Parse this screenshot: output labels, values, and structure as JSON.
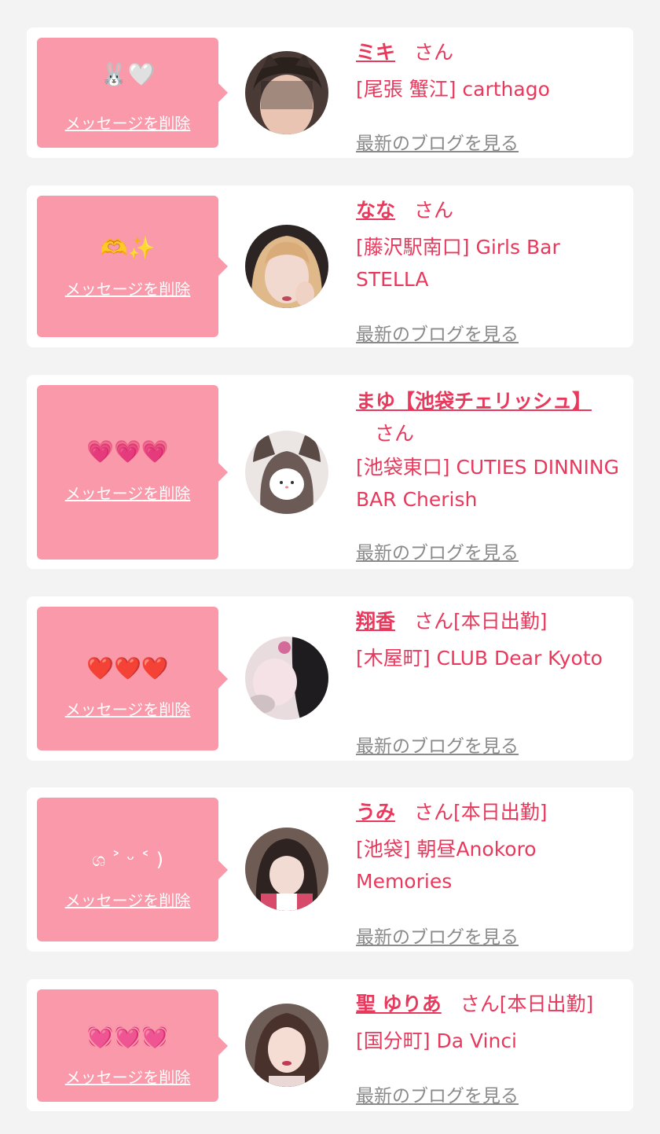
{
  "delete_label": "メッセージを削除",
  "blog_label": "最新のブログを見る",
  "san_label": "さん",
  "attending_label": "さん[本日出勤]",
  "colors": {
    "accent": "#e8395d",
    "bubble": "#fa99a9",
    "link_gray": "#8a8a8a",
    "background": "#f3f3f3"
  },
  "cards": [
    {
      "stamp": "🐰🤍",
      "name": "ミキ",
      "suffix": "さん",
      "shop": "[尾張 蟹江] carthago"
    },
    {
      "stamp": "🫶✨",
      "name": "なな",
      "suffix": "さん",
      "shop": "[藤沢駅南口] Girls Bar STELLA"
    },
    {
      "stamp": "💗💗💗",
      "name": "まゆ【池袋チェリッシュ】",
      "suffix": "さん",
      "shop": "[池袋東口] CUTIES DINNING BAR Cherish"
    },
    {
      "stamp": "❤️❤️❤️",
      "name": "翔香",
      "suffix": "さん[本日出勤]",
      "shop": "[木屋町] CLUB Dear Kyoto"
    },
    {
      "stamp": "ශ ˃ ᵕ ˂ )",
      "name": "うみ",
      "suffix": "さん[本日出勤]",
      "shop": "[池袋] 朝昼Anokoro Memories"
    },
    {
      "stamp": "💓💓💓",
      "name": "聖 ゆりあ",
      "suffix": "さん[本日出勤]",
      "shop": "[国分町] Da Vinci"
    }
  ]
}
